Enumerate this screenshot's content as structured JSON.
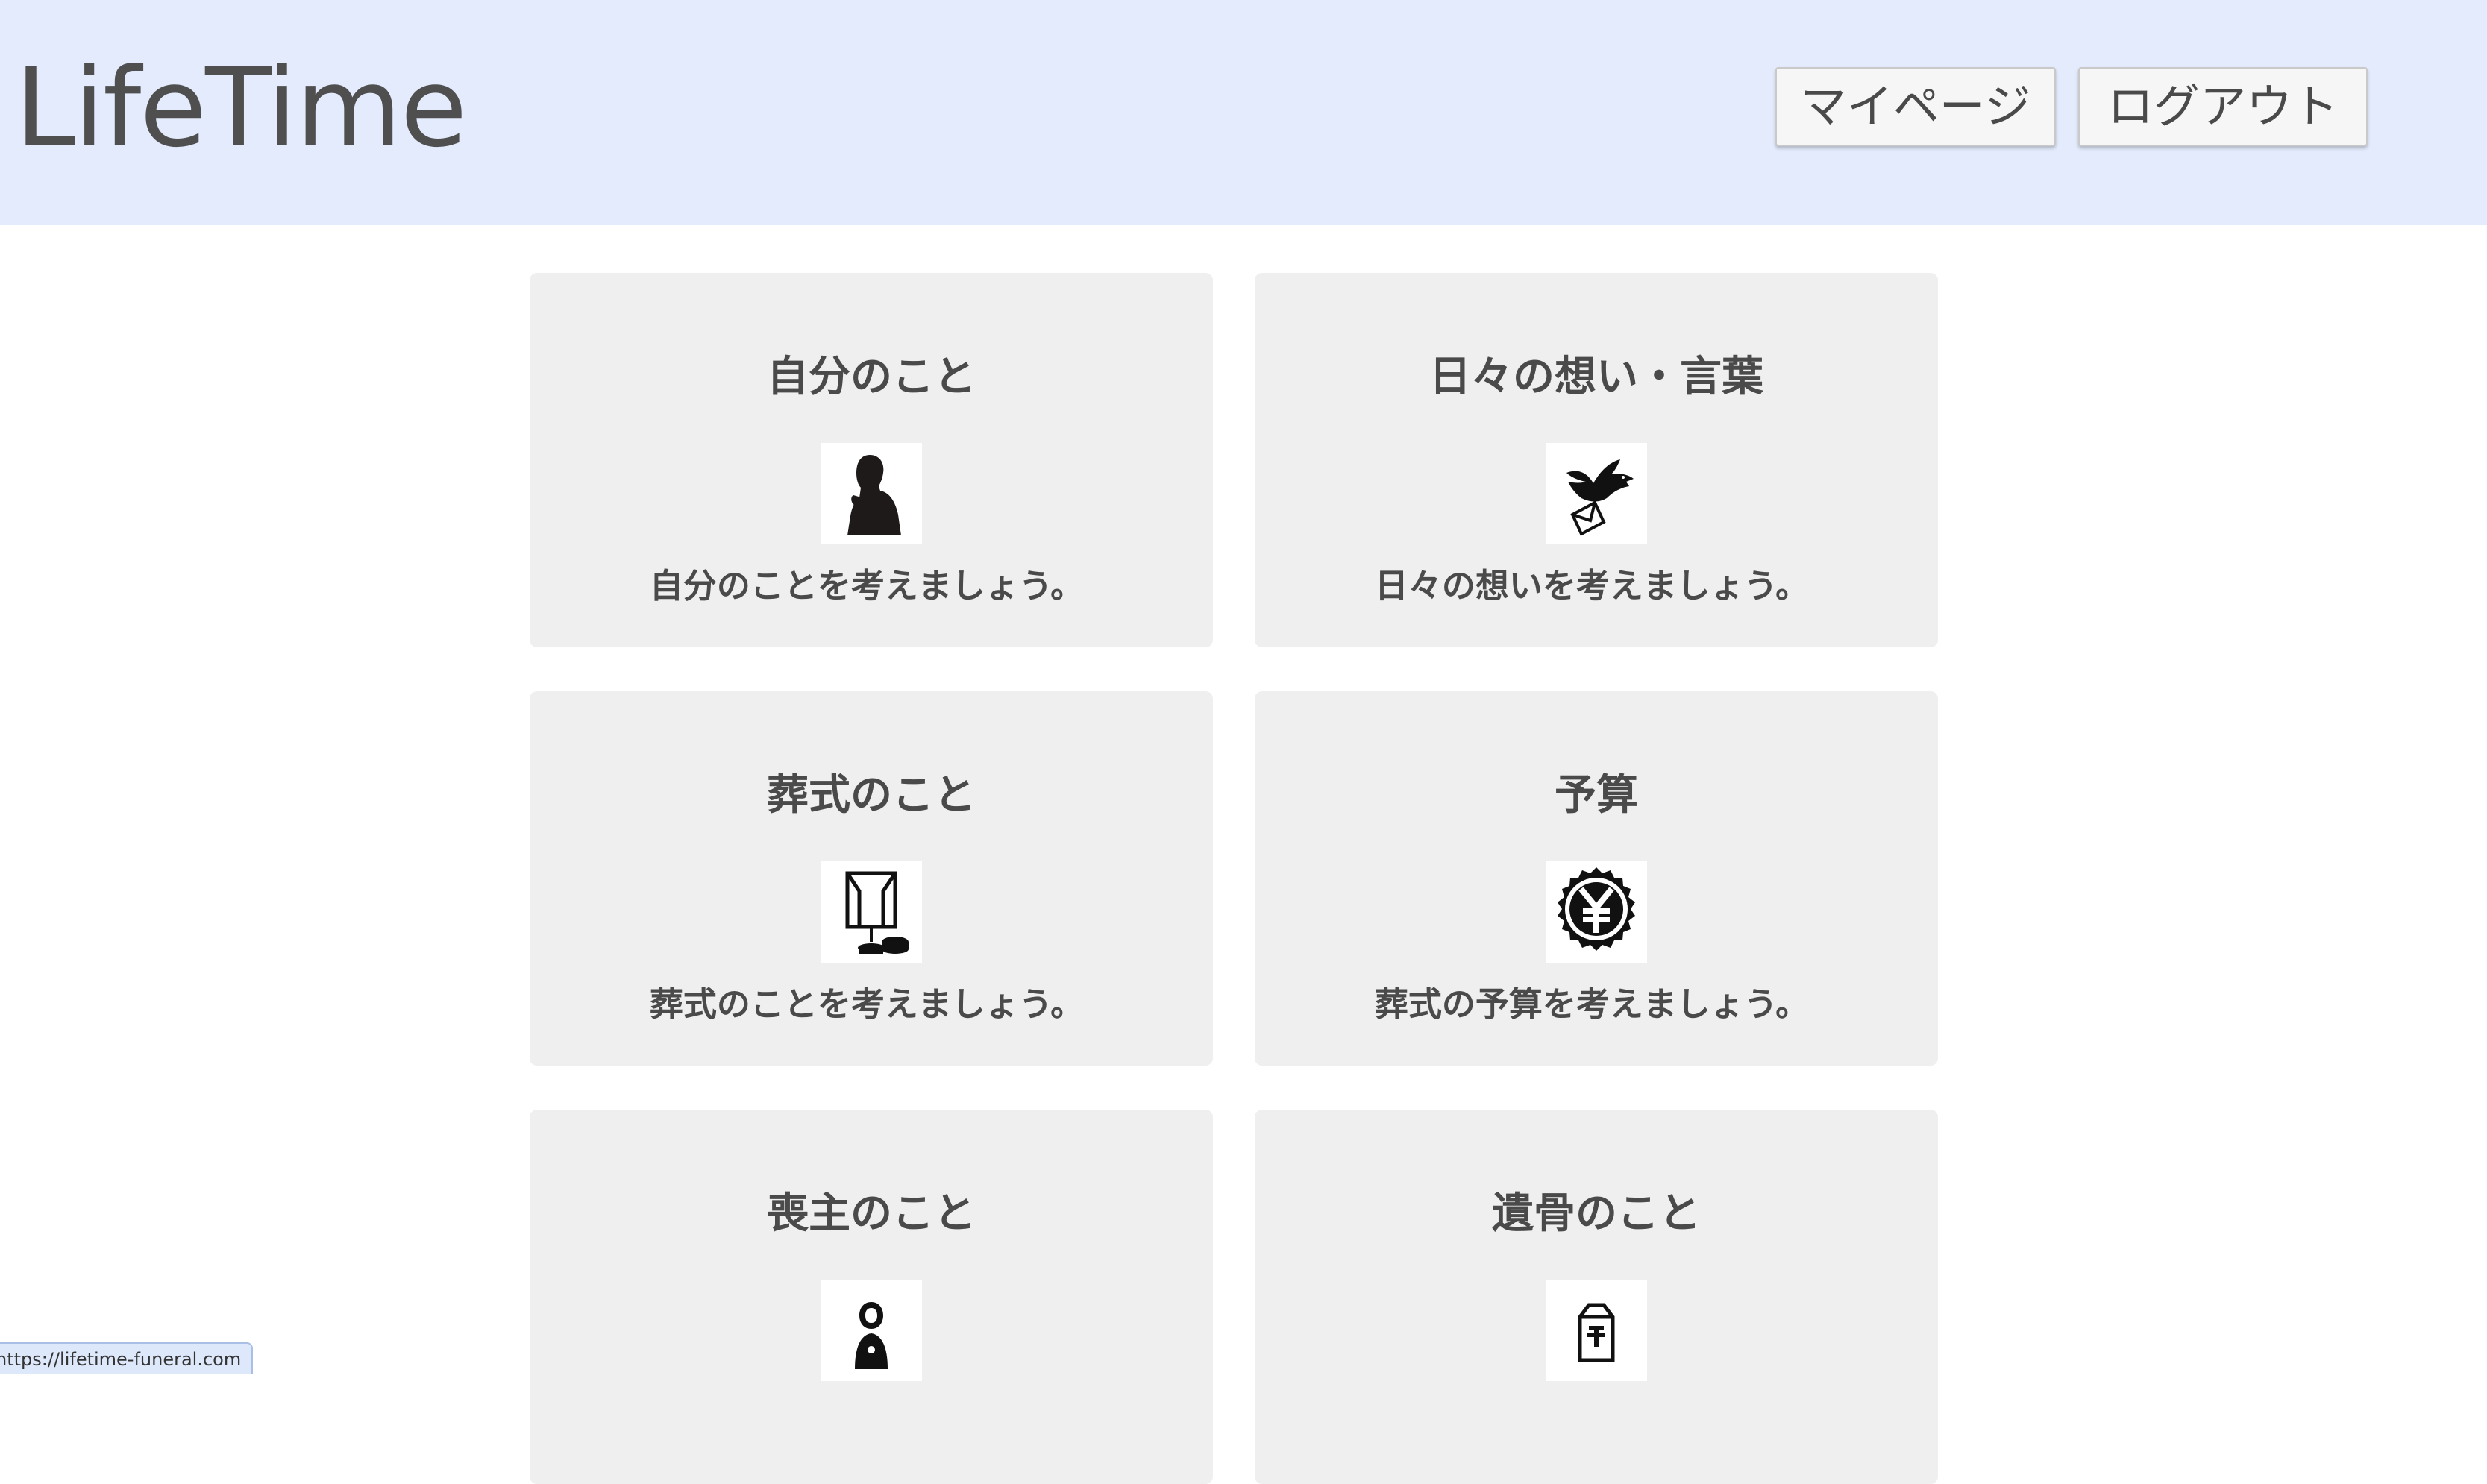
{
  "header": {
    "logo": "LifeTime",
    "mypage_label": "マイページ",
    "logout_label": "ログアウト",
    "background": "#e3ebfc"
  },
  "cards": [
    {
      "title": "自分のこと",
      "icon": "thinking-person-icon",
      "description": "自分のことを考えましょう。"
    },
    {
      "title": "日々の想い・言葉",
      "icon": "dove-letter-icon",
      "description": "日々の想いを考えましょう。"
    },
    {
      "title": "葬式のこと",
      "icon": "altar-icon",
      "description": "葬式のことを考えましょう。"
    },
    {
      "title": "予算",
      "icon": "yen-seal-icon",
      "description": "葬式の予算を考えましょう。"
    },
    {
      "title": "喪主のこと",
      "icon": "chief-mourner-icon",
      "description": ""
    },
    {
      "title": "遺骨のこと",
      "icon": "urn-icon",
      "description": ""
    }
  ],
  "status_bar": {
    "url": "https://lifetime-funeral.com"
  },
  "colors": {
    "card_background": "#efefef",
    "text": "#4a4a4a"
  }
}
